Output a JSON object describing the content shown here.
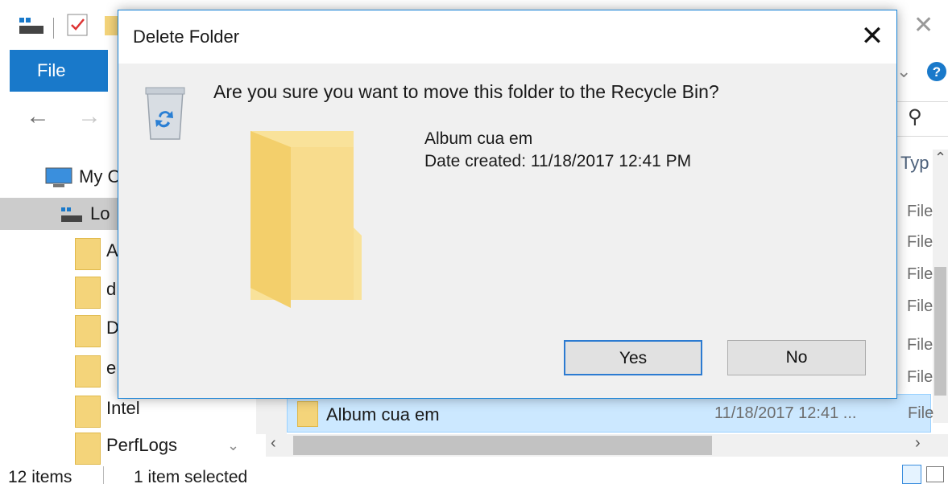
{
  "explorer": {
    "file_tab_label": "File",
    "nav_items": [
      {
        "label": "My C",
        "icon": "computer-icon"
      },
      {
        "label": "Lo",
        "icon": "drive-icon"
      },
      {
        "label": "A",
        "icon": "folder-icon"
      },
      {
        "label": "d",
        "icon": "folder-icon"
      },
      {
        "label": "D",
        "icon": "folder-icon"
      },
      {
        "label": "e",
        "icon": "folder-icon"
      },
      {
        "label": "Intel",
        "icon": "folder-icon"
      },
      {
        "label": "PerfLogs",
        "icon": "folder-icon"
      }
    ],
    "list": {
      "type_header": "Typ",
      "type_cells": [
        "File",
        "File",
        "File",
        "File",
        "File",
        "File"
      ],
      "selected_row": {
        "name": "Album cua em",
        "date": "11/18/2017 12:41 ...",
        "type": "File"
      }
    },
    "status": {
      "items": "12 items",
      "selected": "1 item selected"
    }
  },
  "dialog": {
    "title": "Delete Folder",
    "close_label": "✕",
    "question": "Are you sure you want to move this folder to the Recycle Bin?",
    "item_name": "Album cua em",
    "item_date": "Date created: 11/18/2017 12:41 PM",
    "yes_label": "Yes",
    "no_label": "No"
  },
  "colors": {
    "accent": "#1979ca",
    "dialog_border": "#1883d7",
    "folder": "#f4d47a",
    "selection": "#cce8ff"
  }
}
